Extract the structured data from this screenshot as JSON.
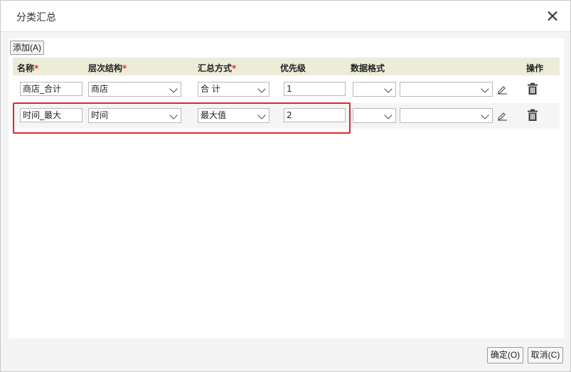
{
  "dialog": {
    "title": "分类汇总"
  },
  "toolbar": {
    "add_label": "添加(A)"
  },
  "table": {
    "columns": {
      "name": "名称",
      "hierarchy": "层次结构",
      "method": "汇总方式",
      "priority": "优先级",
      "format": "数据格式",
      "action": "操作"
    },
    "required_mark": "*",
    "rows": [
      {
        "name": "商店_合计",
        "hierarchy": "商店",
        "method": "合 计",
        "priority": "1",
        "format_type": "",
        "format_value": ""
      },
      {
        "name": "时间_最大",
        "hierarchy": "时间",
        "method": "最大值",
        "priority": "2",
        "format_type": "",
        "format_value": ""
      }
    ]
  },
  "footer": {
    "ok_label": "确定(O)",
    "cancel_label": "取消(C)"
  },
  "colors": {
    "header_bg": "#ececd8",
    "highlight": "#e0252e",
    "required": "#e0302e"
  }
}
